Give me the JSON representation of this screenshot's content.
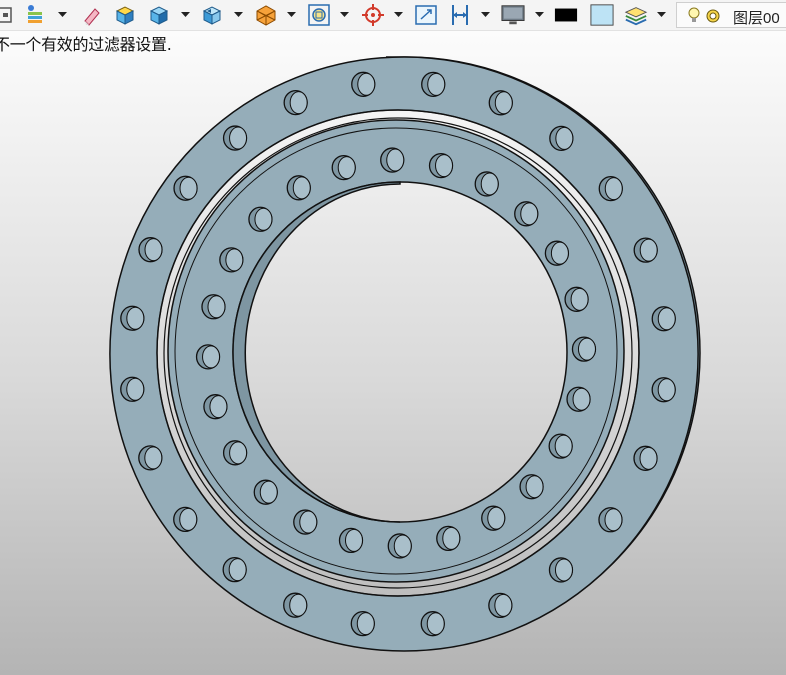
{
  "toolbar": {
    "items": [
      {
        "icon": "frame-icon"
      },
      {
        "icon": "layer-stack-icon",
        "dropdown": true
      },
      {
        "icon": "pencil-eraser-icon"
      },
      {
        "icon": "solid-box-icon"
      },
      {
        "icon": "shaded-box-icon",
        "dropdown": true
      },
      {
        "icon": "view-orient-icon",
        "dropdown": true
      },
      {
        "icon": "wireframe-cube-icon",
        "dropdown": true
      },
      {
        "icon": "zoom-fit-icon",
        "dropdown": true
      },
      {
        "icon": "target-center-icon",
        "dropdown": true
      },
      {
        "icon": "zoom-window-icon"
      },
      {
        "icon": "dimension-icon",
        "dropdown": true
      },
      {
        "icon": "display-monitor-icon",
        "dropdown": true
      },
      {
        "icon": "color-black-swatch"
      },
      {
        "icon": "color-light-blue-swatch"
      },
      {
        "icon": "layers-icon",
        "dropdown": true
      }
    ],
    "layer_selector": {
      "label": "图层00",
      "icons": [
        "lightbulb-icon",
        "freeze-icon"
      ]
    }
  },
  "status_message": "不一个有效的过滤器设置.",
  "colors": {
    "part_face": "#95adb9",
    "part_shadow": "#7e96a2",
    "outline": "#111111",
    "swatch_black": "#000000",
    "swatch_light_blue": "#bde3f5"
  },
  "model": {
    "type": "slewing-ring-bearing",
    "outer_ring_holes": 24,
    "inner_ring_holes": 24
  }
}
